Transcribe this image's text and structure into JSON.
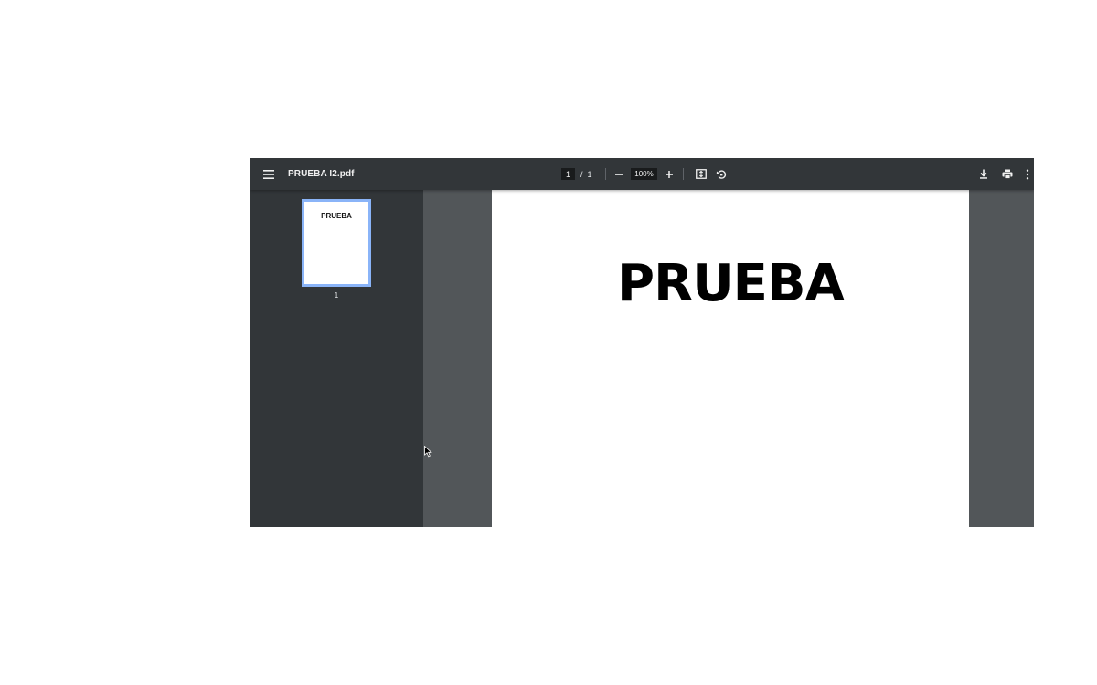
{
  "viewer": {
    "title": "PRUEBA I2.pdf",
    "current_page": "1",
    "page_separator": "/",
    "total_pages": "1",
    "zoom": "100%"
  },
  "icons": {
    "menu": "hamburger-menu-icon",
    "zoom_out": "minus-icon",
    "zoom_in": "plus-icon",
    "fit": "fit-to-page-icon",
    "rotate": "rotate-counterclockwise-icon",
    "download": "download-icon",
    "print": "print-icon",
    "more": "more-vert-icon"
  },
  "sidebar": {
    "thumbnails": [
      {
        "text": "PRUEBA",
        "page_number": "1",
        "selected": true
      }
    ]
  },
  "document": {
    "page_text": "PRUEBA"
  },
  "colors": {
    "toolbar": "#323639",
    "viewer_background": "#525659",
    "thumbnail_selected_border": "#8ab4f8"
  }
}
